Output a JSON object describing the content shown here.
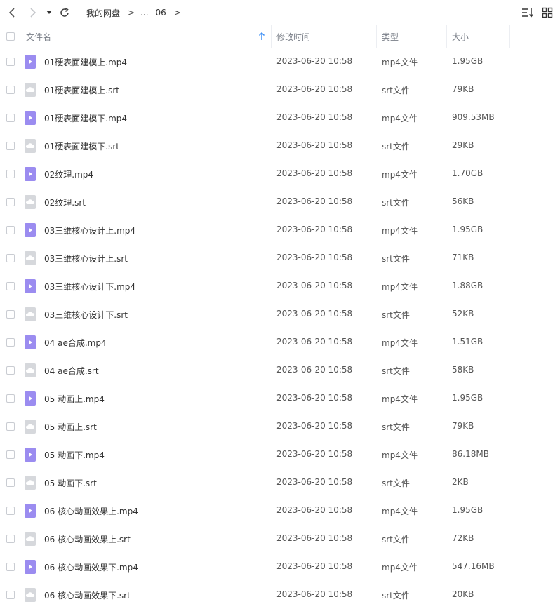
{
  "toolbar": {
    "back_icon": "chevron-left-icon",
    "forward_icon": "chevron-right-icon",
    "dropdown_icon": "caret-down-icon",
    "refresh_icon": "refresh-icon",
    "sort_icon": "sort-list-icon",
    "grid_icon": "grid-view-icon"
  },
  "breadcrumb": {
    "root": "我的网盘",
    "sep1": ">",
    "ellipsis": "...",
    "current": "06",
    "sep2": ">"
  },
  "header": {
    "name": "文件名",
    "modified": "修改时间",
    "type": "类型",
    "size": "大小",
    "sort_icon": "arrow-up-icon"
  },
  "colors": {
    "video_icon": "#9b8cf0",
    "srt_icon": "#d6d8dc",
    "sort_arrow": "#3d8ff5"
  },
  "files": [
    {
      "name": "01硬表面建模上.mp4",
      "date": "2023-06-20 10:58",
      "type": "mp4文件",
      "size": "1.95GB",
      "icon": "video-file-icon"
    },
    {
      "name": "01硬表面建模上.srt",
      "date": "2023-06-20 10:58",
      "type": "srt文件",
      "size": "79KB",
      "icon": "srt-file-icon"
    },
    {
      "name": "01硬表面建模下.mp4",
      "date": "2023-06-20 10:58",
      "type": "mp4文件",
      "size": "909.53MB",
      "icon": "video-file-icon"
    },
    {
      "name": "01硬表面建模下.srt",
      "date": "2023-06-20 10:58",
      "type": "srt文件",
      "size": "29KB",
      "icon": "srt-file-icon"
    },
    {
      "name": "02纹理.mp4",
      "date": "2023-06-20 10:58",
      "type": "mp4文件",
      "size": "1.70GB",
      "icon": "video-file-icon"
    },
    {
      "name": "02纹理.srt",
      "date": "2023-06-20 10:58",
      "type": "srt文件",
      "size": "56KB",
      "icon": "srt-file-icon"
    },
    {
      "name": "03三维核心设计上.mp4",
      "date": "2023-06-20 10:58",
      "type": "mp4文件",
      "size": "1.95GB",
      "icon": "video-file-icon"
    },
    {
      "name": "03三维核心设计上.srt",
      "date": "2023-06-20 10:58",
      "type": "srt文件",
      "size": "71KB",
      "icon": "srt-file-icon"
    },
    {
      "name": "03三维核心设计下.mp4",
      "date": "2023-06-20 10:58",
      "type": "mp4文件",
      "size": "1.88GB",
      "icon": "video-file-icon"
    },
    {
      "name": "03三维核心设计下.srt",
      "date": "2023-06-20 10:58",
      "type": "srt文件",
      "size": "52KB",
      "icon": "srt-file-icon"
    },
    {
      "name": "04 ae合成.mp4",
      "date": "2023-06-20 10:58",
      "type": "mp4文件",
      "size": "1.51GB",
      "icon": "video-file-icon"
    },
    {
      "name": "04 ae合成.srt",
      "date": "2023-06-20 10:58",
      "type": "srt文件",
      "size": "58KB",
      "icon": "srt-file-icon"
    },
    {
      "name": "05 动画上.mp4",
      "date": "2023-06-20 10:58",
      "type": "mp4文件",
      "size": "1.95GB",
      "icon": "video-file-icon"
    },
    {
      "name": "05 动画上.srt",
      "date": "2023-06-20 10:58",
      "type": "srt文件",
      "size": "79KB",
      "icon": "srt-file-icon"
    },
    {
      "name": "05 动画下.mp4",
      "date": "2023-06-20 10:58",
      "type": "mp4文件",
      "size": "86.18MB",
      "icon": "video-file-icon"
    },
    {
      "name": "05 动画下.srt",
      "date": "2023-06-20 10:58",
      "type": "srt文件",
      "size": "2KB",
      "icon": "srt-file-icon"
    },
    {
      "name": "06 核心动画效果上.mp4",
      "date": "2023-06-20 10:58",
      "type": "mp4文件",
      "size": "1.95GB",
      "icon": "video-file-icon"
    },
    {
      "name": "06 核心动画效果上.srt",
      "date": "2023-06-20 10:58",
      "type": "srt文件",
      "size": "72KB",
      "icon": "srt-file-icon"
    },
    {
      "name": "06 核心动画效果下.mp4",
      "date": "2023-06-20 10:58",
      "type": "mp4文件",
      "size": "547.16MB",
      "icon": "video-file-icon"
    },
    {
      "name": "06 核心动画效果下.srt",
      "date": "2023-06-20 10:58",
      "type": "srt文件",
      "size": "20KB",
      "icon": "srt-file-icon"
    }
  ]
}
